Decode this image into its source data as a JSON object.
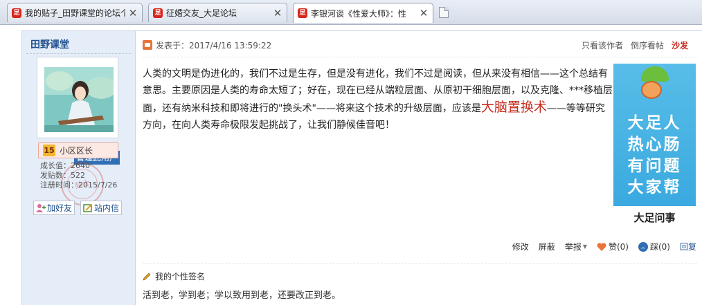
{
  "tabs": [
    {
      "favicon": "forum-favicon",
      "title": "我的贴子_田野课堂的论坛个人中心",
      "active": false
    },
    {
      "favicon": "forum-favicon",
      "title": "征婚交友_大足论坛",
      "active": false
    },
    {
      "favicon": "forum-favicon",
      "title": "李银河谈《性爱大师》：性",
      "active": true
    }
  ],
  "user": {
    "name": "田野课堂",
    "manage_label": "管理此用户",
    "level_num": "15",
    "level_name": "小区区长",
    "stats": [
      "成长值：2640",
      "发贴数：522",
      "注册时间：2015/7/26"
    ],
    "stamp_text": "贴士",
    "add_friend": "加好友",
    "message": "站内信"
  },
  "post": {
    "date_prefix": "发表于：",
    "date": "2017/4/16 13:59:22",
    "author_only": "只看该作者",
    "reverse_order": "倒序看帖",
    "sofa": "沙发",
    "body_part1": "人类的文明是伪进化的，我们不过是生存，但是没有进化，我们不过是阅读，但从来没有相信——这个总结有意思。主要原因是人类的寿命太短了；好在，现在已经从端粒层面、从原初干细胞层面，以及克隆、***移植层面，还有纳米科技和即将进行的\"换头术\"——将来这个技术的升级层面，应该是",
    "body_highlight": "大脑置换术",
    "body_part2": "——等等研究方向，在向人类寿命极限发起挑战了，让我们静候佳音吧！",
    "ad_lines": [
      "大足人",
      "热心肠",
      "有问题",
      "大家帮"
    ],
    "ad_footer": "大足问事",
    "actions": {
      "edit": "修改",
      "block": "屏蔽",
      "report": "举报",
      "like": "赞(0)",
      "dislike": "踩(0)",
      "reply": "回复"
    },
    "signature_title": "我的个性签名",
    "signature": "活到老，学到老；学以致用到老，还要改正到老。"
  },
  "colors": {
    "accent": "#1f4f8c",
    "highlight": "#c42b1c",
    "sidebar_bg": "#e5edf8",
    "ad_bg": "#35a6de"
  }
}
